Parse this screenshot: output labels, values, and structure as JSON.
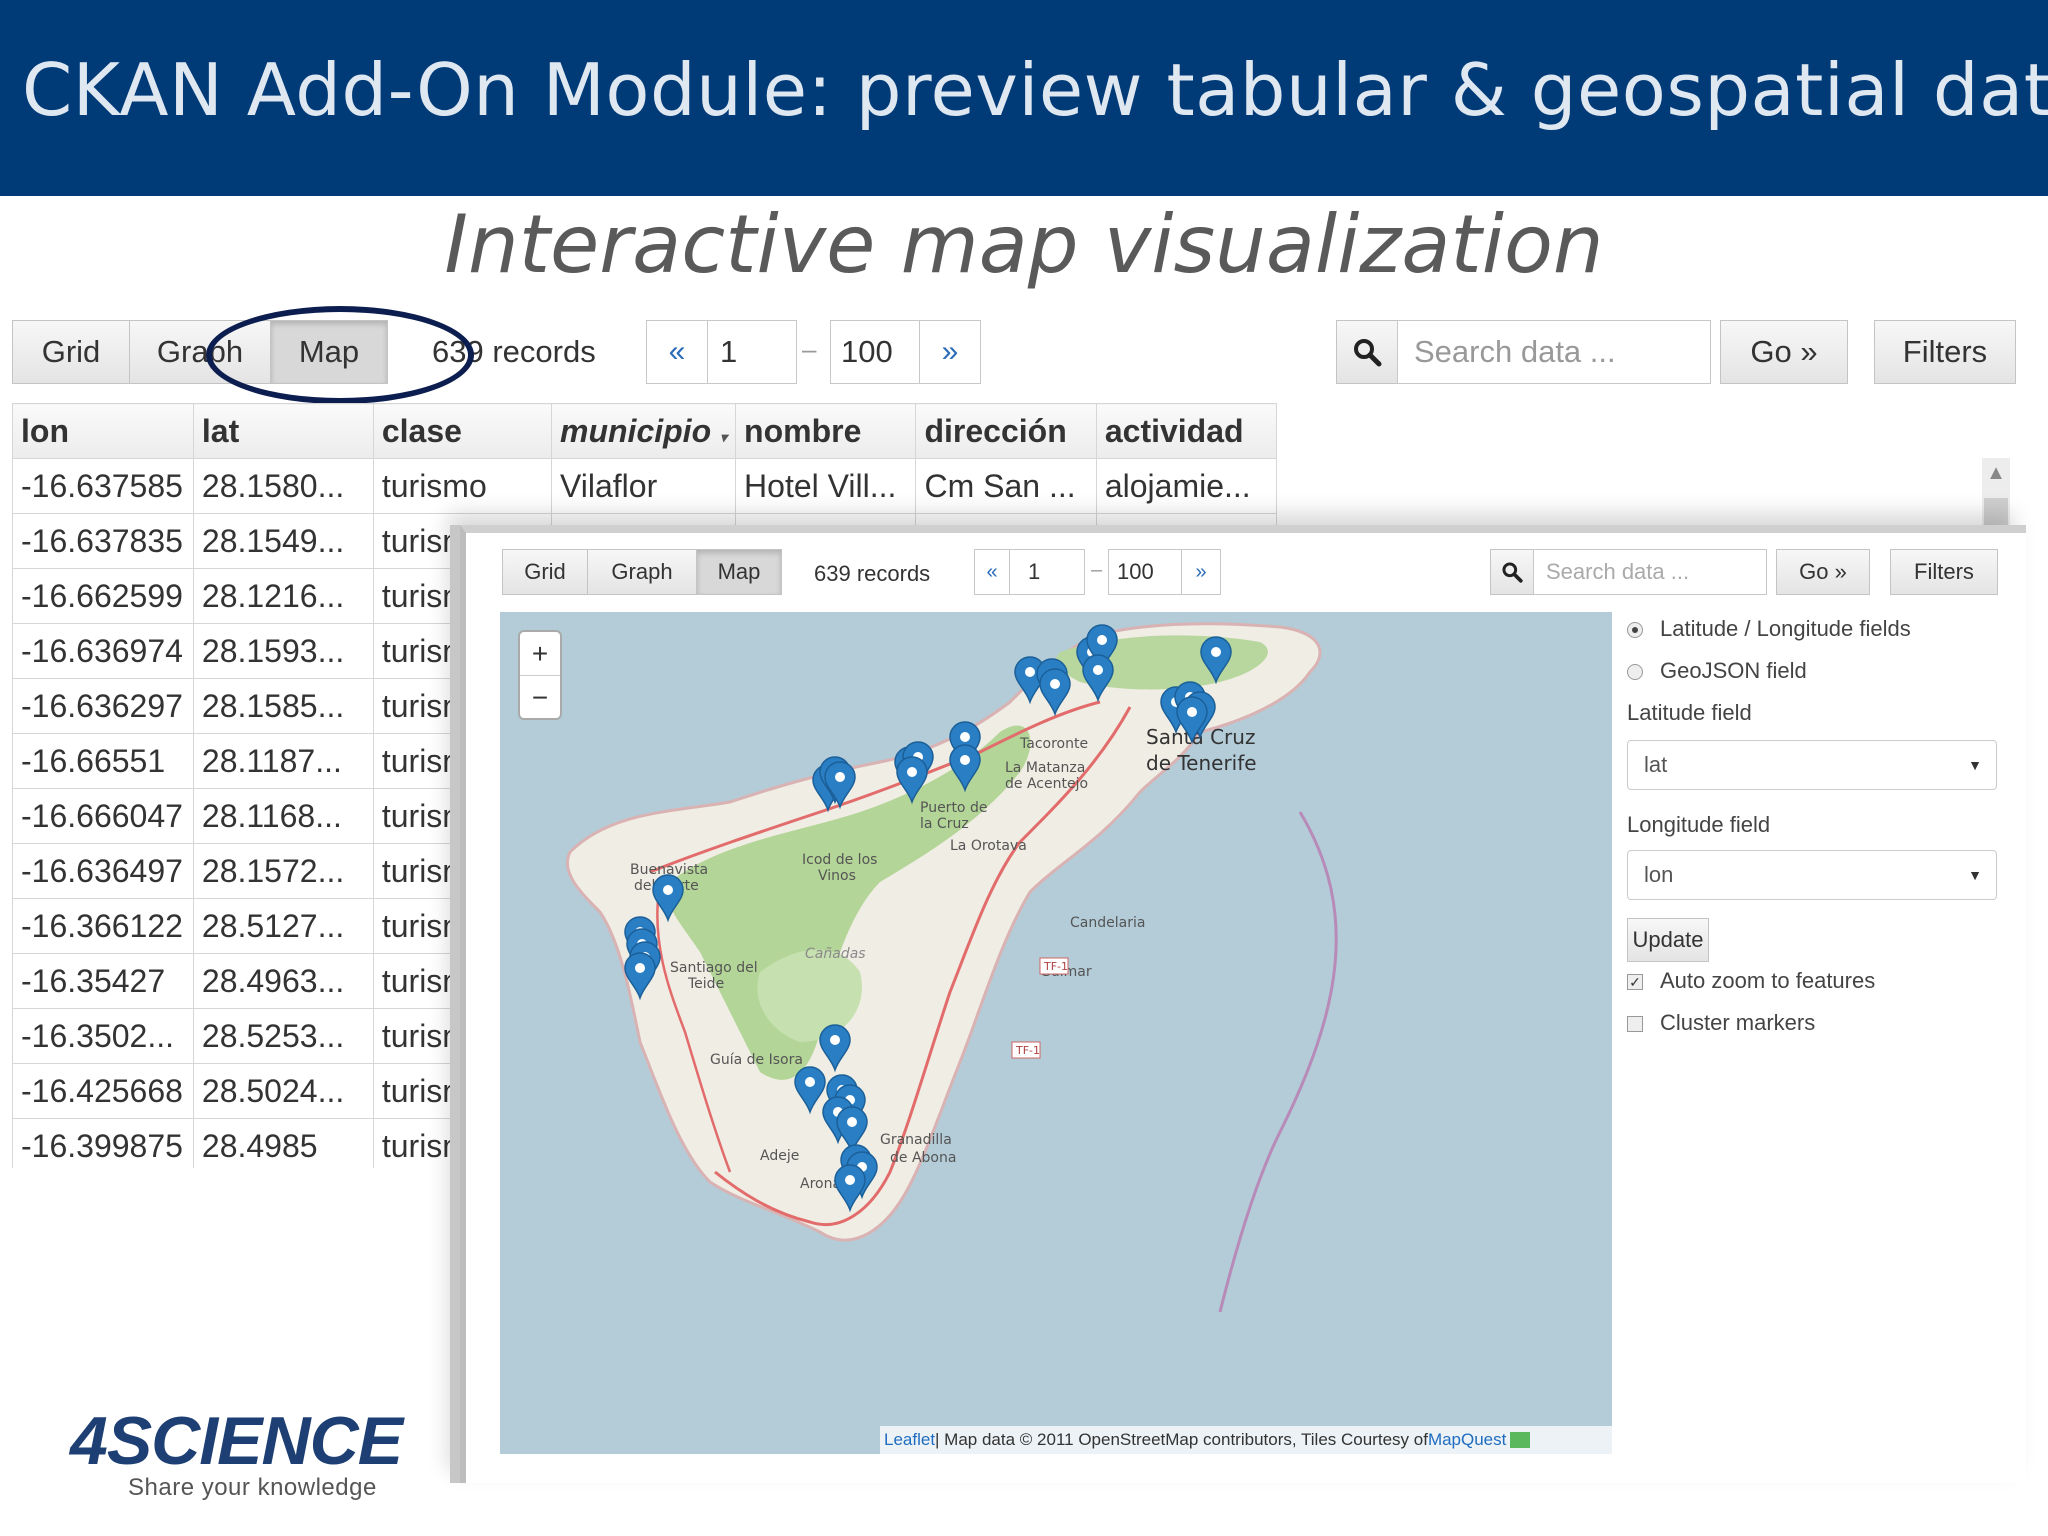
{
  "slide": {
    "title": "CKAN Add-On Module: preview tabular & geospatial data",
    "subtitle": "Interactive map visualization"
  },
  "toolbar": {
    "tabs": [
      "Grid",
      "Graph",
      "Map"
    ],
    "active_tab": "Map",
    "records": "639 records",
    "prev": "«",
    "next": "»",
    "from": "1",
    "dash": "–",
    "to": "100",
    "search_placeholder": "Search data ...",
    "go": "Go »",
    "filters": "Filters"
  },
  "table": {
    "columns": [
      "lon",
      "lat",
      "clase",
      "municipio",
      "nombre",
      "dirección",
      "actividad"
    ],
    "sorted_column": "municipio",
    "rows": [
      [
        "-16.637585",
        "28.1580...",
        "turismo",
        "Vilaflor",
        "Hotel Vill...",
        "Cm San ...",
        "alojamie..."
      ],
      [
        "-16.637835",
        "28.1549...",
        "turismo",
        "",
        "",
        "",
        ""
      ],
      [
        "-16.662599",
        "28.1216...",
        "turismo",
        "",
        "",
        "",
        ""
      ],
      [
        "-16.636974",
        "28.1593...",
        "turismo",
        "",
        "",
        "",
        ""
      ],
      [
        "-16.636297",
        "28.1585...",
        "turismo",
        "",
        "",
        "",
        ""
      ],
      [
        "-16.66551",
        "28.1187...",
        "turismo",
        "",
        "",
        "",
        ""
      ],
      [
        "-16.666047",
        "28.1168...",
        "turismo",
        "",
        "",
        "",
        ""
      ],
      [
        "-16.636497",
        "28.1572...",
        "turismo",
        "",
        "",
        "",
        ""
      ],
      [
        "-16.366122",
        "28.5127...",
        "turismo",
        "",
        "",
        "",
        ""
      ],
      [
        "-16.35427",
        "28.4963...",
        "turismo",
        "",
        "",
        "",
        ""
      ],
      [
        "-16.3502...",
        "28.5253...",
        "turismo",
        "",
        "",
        "",
        ""
      ],
      [
        "-16.425668",
        "28.5024...",
        "turismo",
        "",
        "",
        "",
        ""
      ],
      [
        "-16.399875",
        "28.4985",
        "turismo",
        "",
        "",
        "",
        ""
      ]
    ]
  },
  "map_panel": {
    "zoom_in": "+",
    "zoom_out": "−",
    "place_labels": [
      "Puerto de la Cruz",
      "La Orotava",
      "Tacoronte",
      "Santa Cruz de Tenerife",
      "La Matanza de Acentejo",
      "Icod de los Vinos",
      "Buenavista del Norte",
      "Santiago del Teide",
      "Candelaria",
      "Güímar",
      "Guía de Isora",
      "Adeje",
      "Arona",
      "Granadilla de Abona",
      "Cañadas",
      "TF-1"
    ],
    "attribution": {
      "leaflet": "Leaflet",
      "text": " | Map data © 2011 OpenStreetMap contributors, Tiles Courtesy of ",
      "mapquest": "MapQuest"
    }
  },
  "sidebar": {
    "field_type_options": [
      "Latitude / Longitude fields",
      "GeoJSON field"
    ],
    "selected_field_type": "Latitude / Longitude fields",
    "latitude_label": "Latitude field",
    "latitude_value": "lat",
    "longitude_label": "Longitude field",
    "longitude_value": "lon",
    "update": "Update",
    "auto_zoom": "Auto zoom to features",
    "auto_zoom_checked": true,
    "cluster": "Cluster markers",
    "cluster_checked": false
  },
  "logo": {
    "name": "4SCIENCE",
    "tagline": "Share your knowledge"
  },
  "colors": {
    "header_bg": "#003b78",
    "marker": "#2a7fc4",
    "map_water": "#b3ccd8",
    "map_land": "#f0ede4",
    "map_forest": "#a8d08a",
    "logo": "#1d3f73"
  },
  "icons": [
    "search-icon",
    "map-marker-icon",
    "caret-down-icon",
    "radio-icon",
    "checkbox-icon"
  ]
}
